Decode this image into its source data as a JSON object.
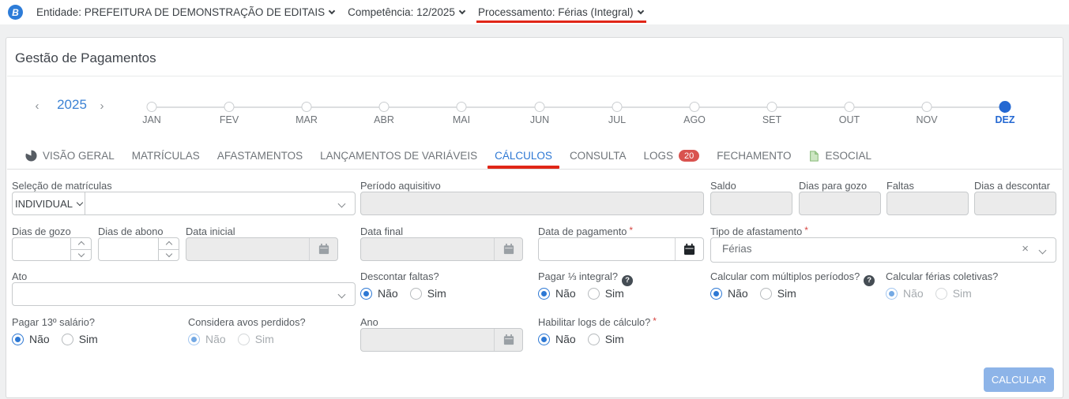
{
  "topbar": {
    "logo_letter": "B",
    "entidade": "Entidade: PREFEITURA DE DEMONSTRAÇÃO DE EDITAIS",
    "competencia": "Competência: 12/2025",
    "processamento": "Processamento: Férias (Integral)"
  },
  "page_title": "Gestão de Pagamentos",
  "timeline": {
    "year": "2025",
    "prev": "‹",
    "next": "›",
    "months": [
      "JAN",
      "FEV",
      "MAR",
      "ABR",
      "MAI",
      "JUN",
      "JUL",
      "AGO",
      "SET",
      "OUT",
      "NOV",
      "DEZ"
    ],
    "active_month": "DEZ"
  },
  "tabs": {
    "visao_geral": "VISÃO GERAL",
    "matriculas": "MATRÍCULAS",
    "afastamentos": "AFASTAMENTOS",
    "lancamentos": "LANÇAMENTOS DE VARIÁVEIS",
    "calculos": "CÁLCULOS",
    "consulta": "CONSULTA",
    "logs": "LOGS",
    "logs_badge": "20",
    "fechamento": "FECHAMENTO",
    "esocial": "ESOCIAL"
  },
  "icons": {
    "help": "?",
    "clear": "×"
  },
  "required_mark": "*",
  "form": {
    "radio_no": "Não",
    "radio_yes": "Sim",
    "selecao_matriculas": {
      "label": "Seleção de matrículas",
      "mode_value": "INDIVIDUAL",
      "value": ""
    },
    "periodo_aquisitivo": {
      "label": "Período aquisitivo",
      "value": "",
      "disabled": true
    },
    "saldo": {
      "label": "Saldo",
      "value": "",
      "disabled": true
    },
    "dias_para_gozo": {
      "label": "Dias para gozo",
      "value": "",
      "disabled": true
    },
    "faltas": {
      "label": "Faltas",
      "value": "",
      "disabled": true
    },
    "dias_a_descontar": {
      "label": "Dias a descontar",
      "value": "",
      "disabled": true
    },
    "dias_de_gozo": {
      "label": "Dias de gozo",
      "value": ""
    },
    "dias_de_abono": {
      "label": "Dias de abono",
      "value": ""
    },
    "data_inicial": {
      "label": "Data inicial",
      "value": "",
      "disabled": true
    },
    "data_final": {
      "label": "Data final",
      "value": "",
      "disabled": true
    },
    "data_de_pagamento": {
      "label": "Data de pagamento",
      "value": "",
      "required": true
    },
    "tipo_de_afastamento": {
      "label": "Tipo de afastamento",
      "value": "Férias",
      "required": true
    },
    "ato": {
      "label": "Ato",
      "value": ""
    },
    "descontar_faltas": {
      "label": "Descontar faltas?",
      "selected": "Não"
    },
    "pagar_terco_integral": {
      "label": "Pagar ⅓ integral?",
      "selected": "Não",
      "has_help": true
    },
    "calcular_multiplos_periodos": {
      "label": "Calcular com múltiplos períodos?",
      "selected": "Não",
      "has_help": true
    },
    "calcular_ferias_coletivas": {
      "label": "Calcular férias coletivas?",
      "selected": "Não",
      "disabled": true
    },
    "pagar_13_salario": {
      "label": "Pagar 13º salário?",
      "selected": "Não"
    },
    "considera_avos_perdidos": {
      "label": "Considera avos perdidos?",
      "selected": "Não",
      "disabled": true
    },
    "ano": {
      "label": "Ano",
      "value": "",
      "disabled": true
    },
    "habilitar_logs": {
      "label": "Habilitar logs de cálculo?",
      "selected": "Não",
      "required": true
    }
  },
  "actions": {
    "calcular": "CALCULAR"
  },
  "colors": {
    "accent_blue": "#2d78d4",
    "annotation_red": "#e02617",
    "badge_red": "#d9534f",
    "button_blue": "#8db4e8",
    "disabled_bg": "#ebebeb"
  }
}
